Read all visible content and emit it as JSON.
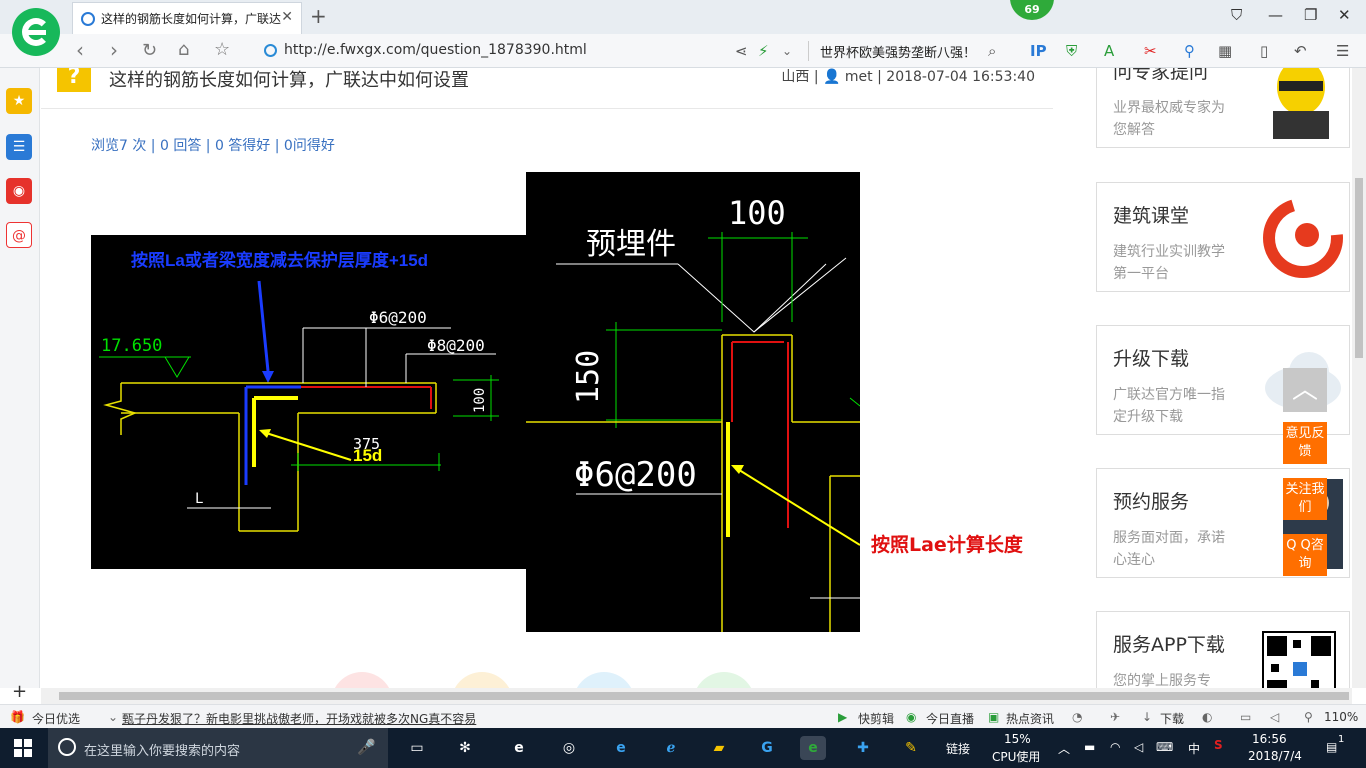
{
  "browser": {
    "tab_title": "这样的钢筋长度如何计算，广联达",
    "url": "http://e.fwxgx.com/question_1878390.html",
    "news_ticker": "世界杯欧美强势垄断八强！",
    "badge_count": "69"
  },
  "question": {
    "title": "这样的钢筋长度如何计算，广联达中如何设置",
    "meta_location": "山西",
    "meta_user": "met",
    "meta_time": "2018-07-04 16:53:40",
    "stats": "浏览7 次 | 0 回答 | 0 答得好 | 0问得好"
  },
  "drawing_left": {
    "annotation_top": "按照La或者梁宽度减去保护层厚度+15d",
    "annotation_15d": "15d",
    "elevation": "17.650",
    "rebar1": "Φ6@200",
    "rebar2": "Φ8@200",
    "dim_100": "100",
    "dim_375": "375",
    "label_L": "L"
  },
  "drawing_right": {
    "label_embed": "预埋件",
    "dim_100": "100",
    "dim_150": "150",
    "rebar": "Φ6@200",
    "annotation": "按照Lae计算长度"
  },
  "sidebar_cards": [
    {
      "title": "问专家提问",
      "desc": "业界最权威专家为您解答"
    },
    {
      "title": "建筑课堂",
      "desc": "建筑行业实训教学第一平台"
    },
    {
      "title": "升级下载",
      "desc": "广联达官方唯一指定升级下载"
    },
    {
      "title": "预约服务",
      "desc": "服务面对面，承诺心连心"
    },
    {
      "title": "服务APP下载",
      "desc": "您的掌上服务专"
    }
  ],
  "float_buttons": {
    "feedback": "意见反馈",
    "follow": "关注我们",
    "qq": "Q Q咨询"
  },
  "statusbar": {
    "today": "今日优选",
    "headline": "甄子丹发狠了？新电影里挑战傲老师，开场戏就被多次NG真不容易",
    "kuaijianji": "快剪辑",
    "live": "今日直播",
    "hotnews": "热点资讯",
    "download": "下载",
    "zoom": "110%"
  },
  "taskbar": {
    "search_placeholder": "在这里输入你要搜索的内容",
    "link": "链接",
    "cpu_pct": "15%",
    "cpu_label": "CPU使用",
    "ime": "中",
    "time": "16:56",
    "date": "2018/7/4",
    "notify": "1"
  },
  "colors": {
    "cad_yellow": "#e8e000",
    "cad_green": "#00e000",
    "cad_blue": "#1010ff",
    "cad_red": "#e01010",
    "accent_orange": "#ff6f00"
  }
}
